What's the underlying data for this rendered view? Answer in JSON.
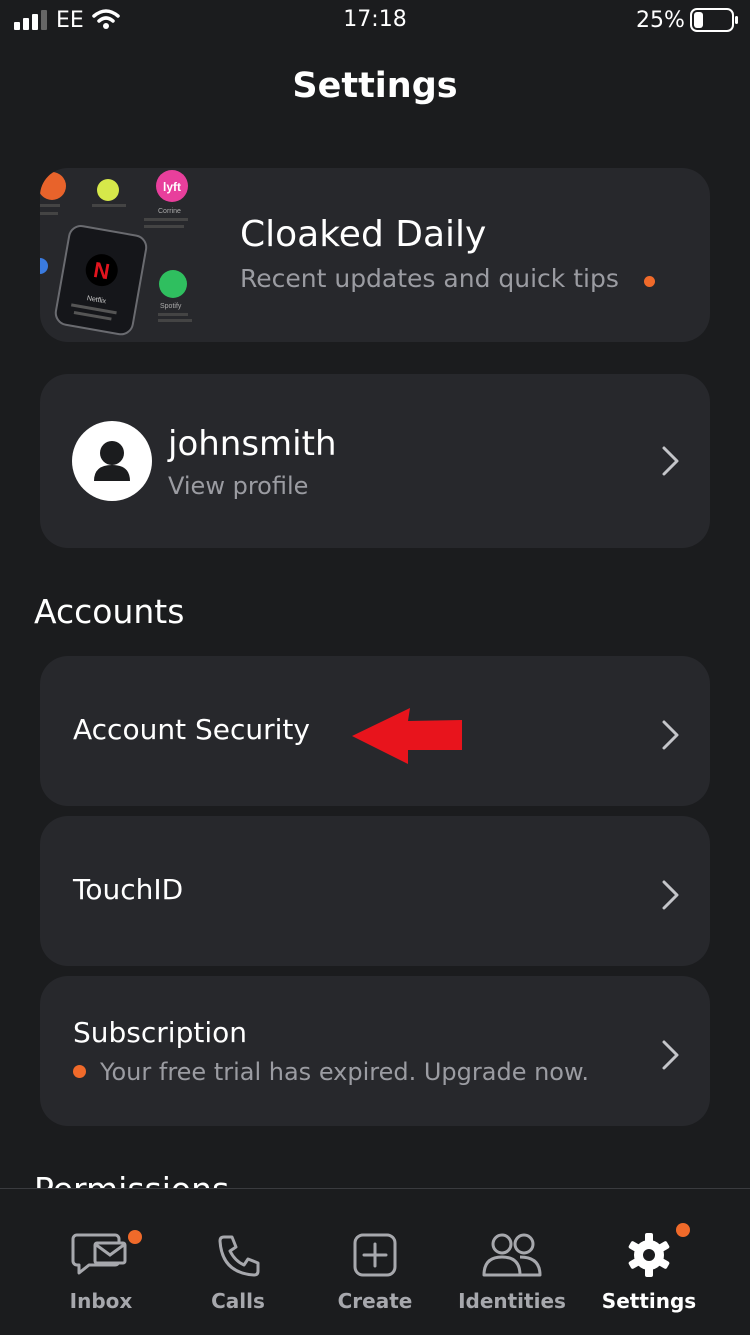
{
  "status_bar": {
    "carrier": "EE",
    "time": "17:18",
    "battery": "25%"
  },
  "header": {
    "title": "Settings"
  },
  "daily_card": {
    "title": "Cloaked Daily",
    "subtitle": "Recent updates and quick tips",
    "art_labels": {
      "netflix": "Netflix",
      "lyft": "lyft",
      "spotify": "Spotify",
      "corrine": "Corrine"
    }
  },
  "profile": {
    "username": "johnsmith",
    "link": "View profile"
  },
  "accounts": {
    "heading": "Accounts",
    "items": [
      {
        "label": "Account Security"
      },
      {
        "label": "TouchID"
      },
      {
        "label": "Subscription",
        "sub": "Your free trial has expired. Upgrade now."
      }
    ]
  },
  "next_section": "Permissions",
  "tabs": [
    {
      "label": "Inbox",
      "icon": "inbox-icon",
      "badge": true
    },
    {
      "label": "Calls",
      "icon": "phone-icon",
      "badge": false
    },
    {
      "label": "Create",
      "icon": "plus-square-icon",
      "badge": false
    },
    {
      "label": "Identities",
      "icon": "people-icon",
      "badge": false
    },
    {
      "label": "Settings",
      "icon": "gear-icon",
      "badge": true,
      "active": true
    }
  ],
  "colors": {
    "background": "#1b1c1e",
    "card": "#27282c",
    "accent": "#f06a2a",
    "annotation_arrow": "#e8141c"
  }
}
